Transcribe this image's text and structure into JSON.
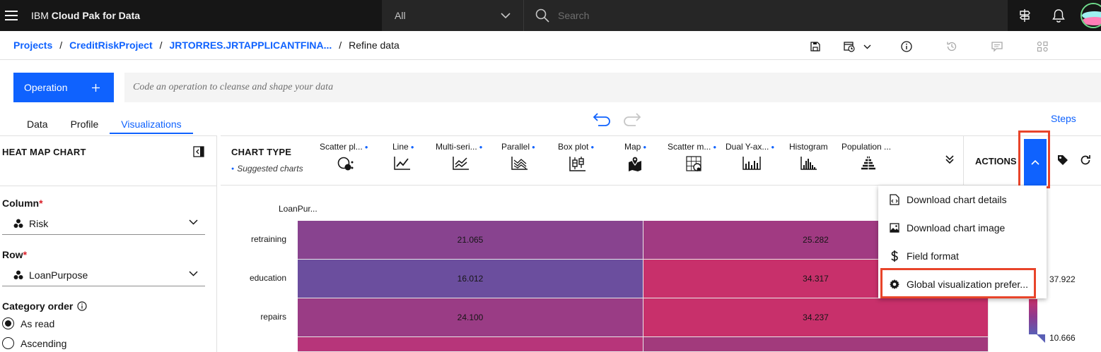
{
  "header": {
    "brand_prefix": "IBM",
    "brand_name": "Cloud Pak for Data",
    "scope_value": "All",
    "search_placeholder": "Search"
  },
  "breadcrumb": {
    "items": [
      "Projects",
      "CreditRiskProject",
      "JRTORRES.JRTAPPLICANTFINA..."
    ],
    "current": "Refine data"
  },
  "operation": {
    "button_label": "Operation",
    "input_placeholder": "Code an operation to cleanse and shape your data"
  },
  "tabs": [
    {
      "label": "Data"
    },
    {
      "label": "Profile"
    },
    {
      "label": "Visualizations",
      "active": true
    }
  ],
  "steps_label": "Steps",
  "left_panel": {
    "title": "HEAT MAP CHART",
    "column_label": "Column",
    "column_value": "Risk",
    "row_label": "Row",
    "row_value": "LoanPurpose",
    "category_order_label": "Category order",
    "options": [
      "As read",
      "Ascending"
    ],
    "selected_option": "As read"
  },
  "chart_type": {
    "title": "CHART TYPE",
    "suggested_label": "Suggested charts",
    "types": [
      {
        "label": "Scatter pl...",
        "suggested": true,
        "icon": "scatter-icon"
      },
      {
        "label": "Line",
        "suggested": true,
        "icon": "line-icon"
      },
      {
        "label": "Multi-seri...",
        "suggested": true,
        "icon": "multi-series-icon"
      },
      {
        "label": "Parallel",
        "suggested": true,
        "icon": "parallel-icon"
      },
      {
        "label": "Box plot",
        "suggested": true,
        "icon": "box-plot-icon"
      },
      {
        "label": "Map",
        "suggested": true,
        "icon": "map-icon"
      },
      {
        "label": "Scatter m...",
        "suggested": true,
        "icon": "scatter-matrix-icon"
      },
      {
        "label": "Dual Y-ax...",
        "suggested": true,
        "icon": "dual-y-axis-icon"
      },
      {
        "label": "Histogram",
        "suggested": false,
        "icon": "histogram-icon"
      },
      {
        "label": "Population ...",
        "suggested": false,
        "icon": "population-pyramid-icon"
      }
    ]
  },
  "actions": {
    "label": "ACTIONS",
    "menu": [
      {
        "label": "Download chart details",
        "icon": "code-file-icon"
      },
      {
        "label": "Download chart image",
        "icon": "image-icon"
      },
      {
        "label": "Field format",
        "icon": "dollar-icon"
      },
      {
        "label": "Global visualization prefer...",
        "icon": "settings-icon"
      }
    ]
  },
  "chart_data": {
    "type": "heatmap",
    "title": "LoanPur...",
    "rows": [
      "retraining",
      "education",
      "repairs"
    ],
    "cells": [
      [
        21.065,
        25.282
      ],
      [
        16.012,
        34.317
      ],
      [
        24.1,
        34.237
      ]
    ],
    "legend": {
      "max": "37.922",
      "min": "10.666"
    },
    "colors": {
      "low": "#6b4e9e",
      "mid": "#a03a82",
      "high": "#c8306b"
    }
  }
}
